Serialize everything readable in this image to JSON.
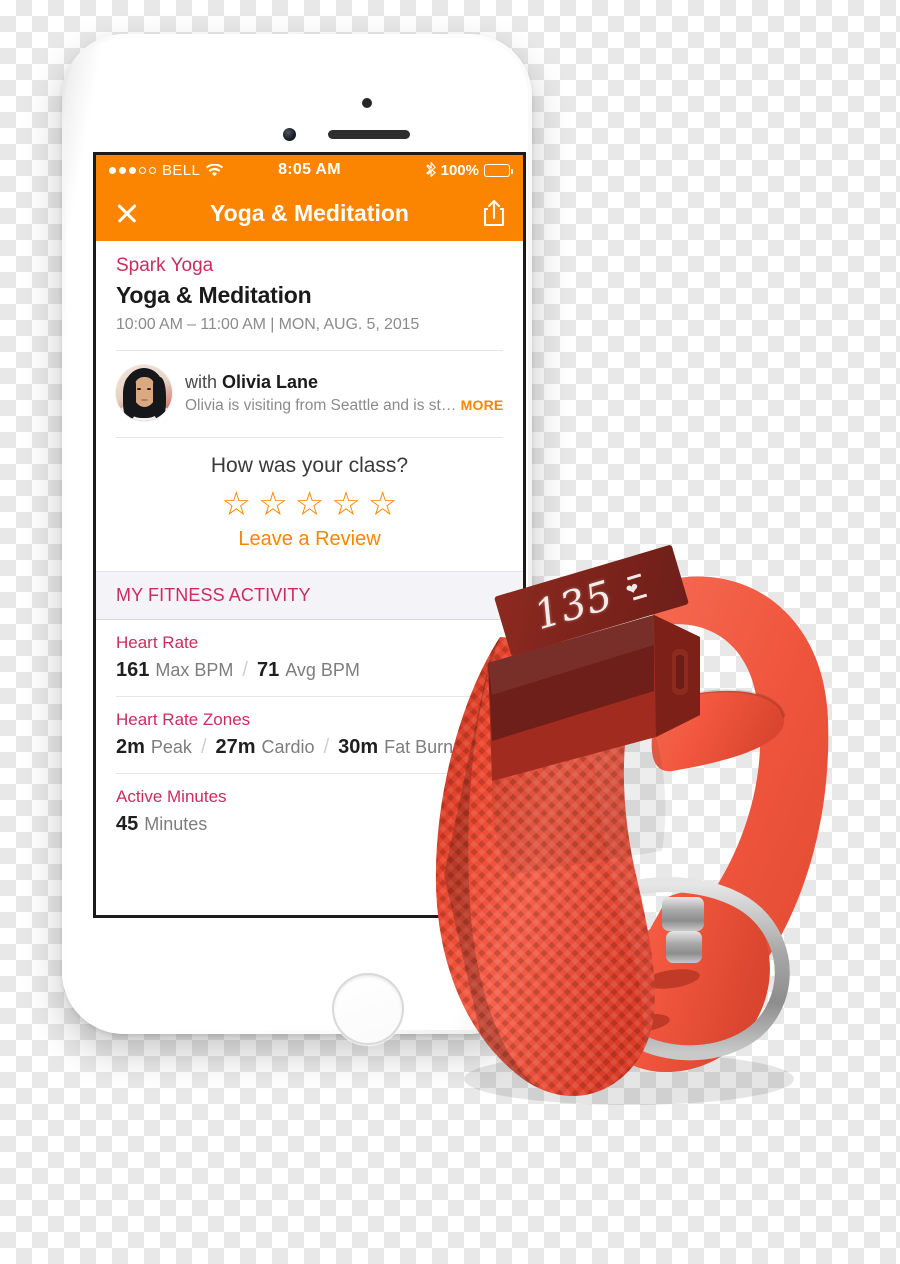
{
  "device": {
    "phone_model": "white-smartphone",
    "tracker_model": "fitness-tracker-wristband"
  },
  "status_bar": {
    "signal_dots_filled": 3,
    "signal_dots_total": 5,
    "carrier": "BELL",
    "wifi_icon": "wifi-icon",
    "time": "8:05 AM",
    "bluetooth_icon": "bluetooth-icon",
    "battery_percent": "100%",
    "battery_level": 100
  },
  "nav_bar": {
    "close_icon": "close-icon",
    "title": "Yoga & Meditation",
    "share_icon": "share-icon",
    "background_color": "#FB8500"
  },
  "class_info": {
    "studio": "Spark Yoga",
    "title": "Yoga & Meditation",
    "schedule": "10:00 AM – 11:00 AM | MON, AUG. 5, 2015"
  },
  "instructor": {
    "avatar": "instructor-avatar",
    "with_label": "with ",
    "name": "Olivia Lane",
    "bio_preview": "Olivia is visiting from Seattle and is st…",
    "more_label": "MORE"
  },
  "rating": {
    "question": "How was your class?",
    "stars": [
      "☆",
      "☆",
      "☆",
      "☆",
      "☆"
    ],
    "stars_filled": 0,
    "stars_total": 5,
    "review_link": "Leave a Review"
  },
  "fitness": {
    "section_title": "MY FITNESS ACTIVITY",
    "rows": [
      {
        "label": "Heart Rate",
        "metrics": [
          {
            "value": "161",
            "unit": "Max BPM"
          },
          {
            "value": "71",
            "unit": "Avg BPM"
          }
        ]
      },
      {
        "label": "Heart Rate Zones",
        "metrics": [
          {
            "value": "2m",
            "unit": "Peak"
          },
          {
            "value": "27m",
            "unit": "Cardio"
          },
          {
            "value": "30m",
            "unit": "Fat Burn"
          }
        ]
      },
      {
        "label": "Active Minutes",
        "metrics": [
          {
            "value": "45",
            "unit": "Minutes"
          }
        ]
      }
    ]
  },
  "tracker": {
    "display_value": "135",
    "display_icon": "heart-icon",
    "band_color": "#F0513A",
    "display_color": "#7E241C"
  },
  "colors": {
    "accent_orange": "#FB8500",
    "accent_magenta": "#CC2B5E",
    "section_bg": "#F4F3F8",
    "text_dark": "#1A1A1A",
    "text_muted": "#8B8B8B"
  }
}
